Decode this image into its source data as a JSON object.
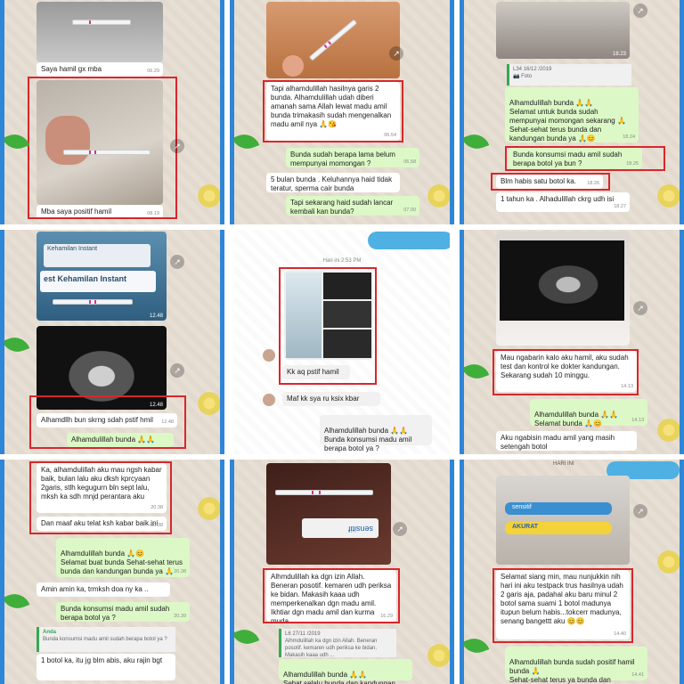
{
  "p1": {
    "msg1": "Saya hamil gx mba",
    "time1": "06.29",
    "msg2": "Mba saya positif hamil",
    "time2": "08.19"
  },
  "p2": {
    "msg1": "Tapi alhamdulillah hasilnya garis 2 bunda. Alhamdulillah udah diberi amanah sama Allah lewat madu amil bunda trimakasih sudah mengenalkan madu amil nya 🙏😘",
    "time1": "06.54",
    "msg2": "Bunda sudah berapa lama belum mempunyai momongan ?",
    "time2": "06.58",
    "msg3": "5 bulan bunda . Keluhannya haid tidak teratur, sperma cair bunda",
    "msg4": "Tapi sekarang haid sudah lancar kembali kan bunda?",
    "time4": "07.00"
  },
  "p3": {
    "img_time": "18.23",
    "quote": "L34 16/12 /2019",
    "quote_sub": "📷 Foto",
    "msg1": "Alhamdulillah bunda 🙏🙏\nSelamat untuk bunda sudah mempunyai momongan sekarang 🙏\nSehat-sehat terus bunda dan kandungan bunda ya 🙏😊",
    "time1": "18.24",
    "msg2": "Bunda konsumsi madu amil sudah berapa botol ya bun ?",
    "time2": "18.25",
    "msg3": "Blm habis satu botol ka.",
    "time3": "18.26",
    "msg4": "1 tahun ka . Alhadulillah ckrg udh isi",
    "time4": "18.27"
  },
  "p4": {
    "label1": "Kehamilan Instant",
    "label2": "est Kehamilan Instant",
    "time1": "12.48",
    "time2": "12.48",
    "msg1": "Alhamdllh bun skrng sdah pstif hmil",
    "time3": "12.48",
    "msg2": "Alhamdulillah bunda 🙏🙏"
  },
  "p5": {
    "header": "Hari ini 2:53 PM",
    "msg1": "Kk aq pstif hamil",
    "msg2": "Maf kk sya ru ksix kbar",
    "msg3": "Alhamdulillah bunda 🙏🙏\nBunda konsumsi madu amil berapa botol ya ?"
  },
  "p6": {
    "msg1": "Mau ngabarin kalo aku hamil, aku sudah test dan kontrol ke dokter kandungan. Sekarang sudah 10 minggu.",
    "time1": "14.13",
    "msg2": "Alhamdulillah bunda 🙏🙏\nSelamat bunda 🙏😊",
    "time2": "14.13",
    "msg3": "Aku ngabisin madu amil yang masih setengah botol"
  },
  "p7": {
    "msg1": "Ka, alhamdulillah aku mau ngsh kabar baik, bulan lalu aku dksh kprcyaan 2garis, stlh kegugurn bln sept lalu, mksh ka sdh mnjd perantara aku",
    "time1": "20.38",
    "msg2": "Dan maaf aku telat ksh kabar baik.ini",
    "time2": "20.38",
    "msg3": "Alhamdulillah bunda 🙏😊\nSelamat buat bunda Sehat-sehat terus bunda dan kandungan bunda ya 🙏",
    "time3": "20.38",
    "msg4": "Amin amin ka, trmksh doa ny ka ..",
    "msg5": "Bunda konsumsi madu amil sudah berapa botol ya ?",
    "time5": "20.39",
    "quote_name": "Anda",
    "quote_text": "Bunda konsumsi madu amil sudah berapa botol ya ?",
    "msg6": "1 botol ka, itu jg blm abis, aku rajin bgt"
  },
  "p8": {
    "brand": "sensitif",
    "msg1": "Alhmdulillah ka dgn izin Allah. Beneran posotif. kemaren udh periksa ke bidan. Makasih kaaa udh memperkenalkan dgn madu amil. Ikhtiar dgn madu amil dan kurma muda",
    "time1": "16.29",
    "quote": "L6 27/11 /2019",
    "quote_text": "Alhmdulillah ka dgn izin Allah. Beneran posotif. kemaren udh periksa ke bidan. Makasih kaaa udh ...",
    "msg2": "Alhamdulillah bunda 🙏🙏\nSehat selalu bunda dan kandungan bunda"
  },
  "p9": {
    "header": "HARI INI",
    "brand1": "sensitif",
    "brand2": "AKURAT",
    "msg1": "Selamat siang min, mau nunjukkin nih hari ini aku testpack trus hasilnya udah 2 garis aja, padahal aku baru minul 2 botol sama suami 1 botol madunya itupun belum habis...tokcerr madunya, senang bangettt aku 😊😊",
    "time1": "14.40",
    "msg2": "Alhamdulillah bunda sudah positif hamil bunda 🙏\nSehat-sehat terus ya bunda dan kandungan bunda 🤗",
    "time2": "14.41"
  }
}
